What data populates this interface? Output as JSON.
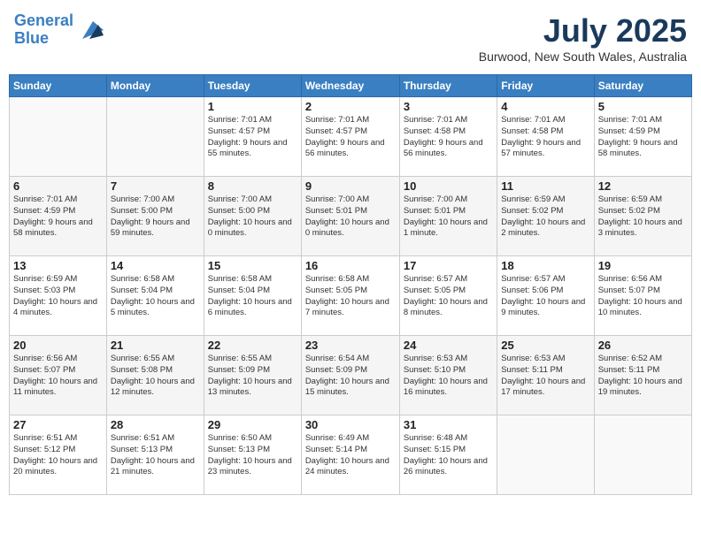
{
  "header": {
    "logo_line1": "General",
    "logo_line2": "Blue",
    "month_year": "July 2025",
    "location": "Burwood, New South Wales, Australia"
  },
  "days_of_week": [
    "Sunday",
    "Monday",
    "Tuesday",
    "Wednesday",
    "Thursday",
    "Friday",
    "Saturday"
  ],
  "weeks": [
    [
      {
        "day": "",
        "info": ""
      },
      {
        "day": "",
        "info": ""
      },
      {
        "day": "1",
        "info": "Sunrise: 7:01 AM\nSunset: 4:57 PM\nDaylight: 9 hours and 55 minutes."
      },
      {
        "day": "2",
        "info": "Sunrise: 7:01 AM\nSunset: 4:57 PM\nDaylight: 9 hours and 56 minutes."
      },
      {
        "day": "3",
        "info": "Sunrise: 7:01 AM\nSunset: 4:58 PM\nDaylight: 9 hours and 56 minutes."
      },
      {
        "day": "4",
        "info": "Sunrise: 7:01 AM\nSunset: 4:58 PM\nDaylight: 9 hours and 57 minutes."
      },
      {
        "day": "5",
        "info": "Sunrise: 7:01 AM\nSunset: 4:59 PM\nDaylight: 9 hours and 58 minutes."
      }
    ],
    [
      {
        "day": "6",
        "info": "Sunrise: 7:01 AM\nSunset: 4:59 PM\nDaylight: 9 hours and 58 minutes."
      },
      {
        "day": "7",
        "info": "Sunrise: 7:00 AM\nSunset: 5:00 PM\nDaylight: 9 hours and 59 minutes."
      },
      {
        "day": "8",
        "info": "Sunrise: 7:00 AM\nSunset: 5:00 PM\nDaylight: 10 hours and 0 minutes."
      },
      {
        "day": "9",
        "info": "Sunrise: 7:00 AM\nSunset: 5:01 PM\nDaylight: 10 hours and 0 minutes."
      },
      {
        "day": "10",
        "info": "Sunrise: 7:00 AM\nSunset: 5:01 PM\nDaylight: 10 hours and 1 minute."
      },
      {
        "day": "11",
        "info": "Sunrise: 6:59 AM\nSunset: 5:02 PM\nDaylight: 10 hours and 2 minutes."
      },
      {
        "day": "12",
        "info": "Sunrise: 6:59 AM\nSunset: 5:02 PM\nDaylight: 10 hours and 3 minutes."
      }
    ],
    [
      {
        "day": "13",
        "info": "Sunrise: 6:59 AM\nSunset: 5:03 PM\nDaylight: 10 hours and 4 minutes."
      },
      {
        "day": "14",
        "info": "Sunrise: 6:58 AM\nSunset: 5:04 PM\nDaylight: 10 hours and 5 minutes."
      },
      {
        "day": "15",
        "info": "Sunrise: 6:58 AM\nSunset: 5:04 PM\nDaylight: 10 hours and 6 minutes."
      },
      {
        "day": "16",
        "info": "Sunrise: 6:58 AM\nSunset: 5:05 PM\nDaylight: 10 hours and 7 minutes."
      },
      {
        "day": "17",
        "info": "Sunrise: 6:57 AM\nSunset: 5:05 PM\nDaylight: 10 hours and 8 minutes."
      },
      {
        "day": "18",
        "info": "Sunrise: 6:57 AM\nSunset: 5:06 PM\nDaylight: 10 hours and 9 minutes."
      },
      {
        "day": "19",
        "info": "Sunrise: 6:56 AM\nSunset: 5:07 PM\nDaylight: 10 hours and 10 minutes."
      }
    ],
    [
      {
        "day": "20",
        "info": "Sunrise: 6:56 AM\nSunset: 5:07 PM\nDaylight: 10 hours and 11 minutes."
      },
      {
        "day": "21",
        "info": "Sunrise: 6:55 AM\nSunset: 5:08 PM\nDaylight: 10 hours and 12 minutes."
      },
      {
        "day": "22",
        "info": "Sunrise: 6:55 AM\nSunset: 5:09 PM\nDaylight: 10 hours and 13 minutes."
      },
      {
        "day": "23",
        "info": "Sunrise: 6:54 AM\nSunset: 5:09 PM\nDaylight: 10 hours and 15 minutes."
      },
      {
        "day": "24",
        "info": "Sunrise: 6:53 AM\nSunset: 5:10 PM\nDaylight: 10 hours and 16 minutes."
      },
      {
        "day": "25",
        "info": "Sunrise: 6:53 AM\nSunset: 5:11 PM\nDaylight: 10 hours and 17 minutes."
      },
      {
        "day": "26",
        "info": "Sunrise: 6:52 AM\nSunset: 5:11 PM\nDaylight: 10 hours and 19 minutes."
      }
    ],
    [
      {
        "day": "27",
        "info": "Sunrise: 6:51 AM\nSunset: 5:12 PM\nDaylight: 10 hours and 20 minutes."
      },
      {
        "day": "28",
        "info": "Sunrise: 6:51 AM\nSunset: 5:13 PM\nDaylight: 10 hours and 21 minutes."
      },
      {
        "day": "29",
        "info": "Sunrise: 6:50 AM\nSunset: 5:13 PM\nDaylight: 10 hours and 23 minutes."
      },
      {
        "day": "30",
        "info": "Sunrise: 6:49 AM\nSunset: 5:14 PM\nDaylight: 10 hours and 24 minutes."
      },
      {
        "day": "31",
        "info": "Sunrise: 6:48 AM\nSunset: 5:15 PM\nDaylight: 10 hours and 26 minutes."
      },
      {
        "day": "",
        "info": ""
      },
      {
        "day": "",
        "info": ""
      }
    ]
  ]
}
